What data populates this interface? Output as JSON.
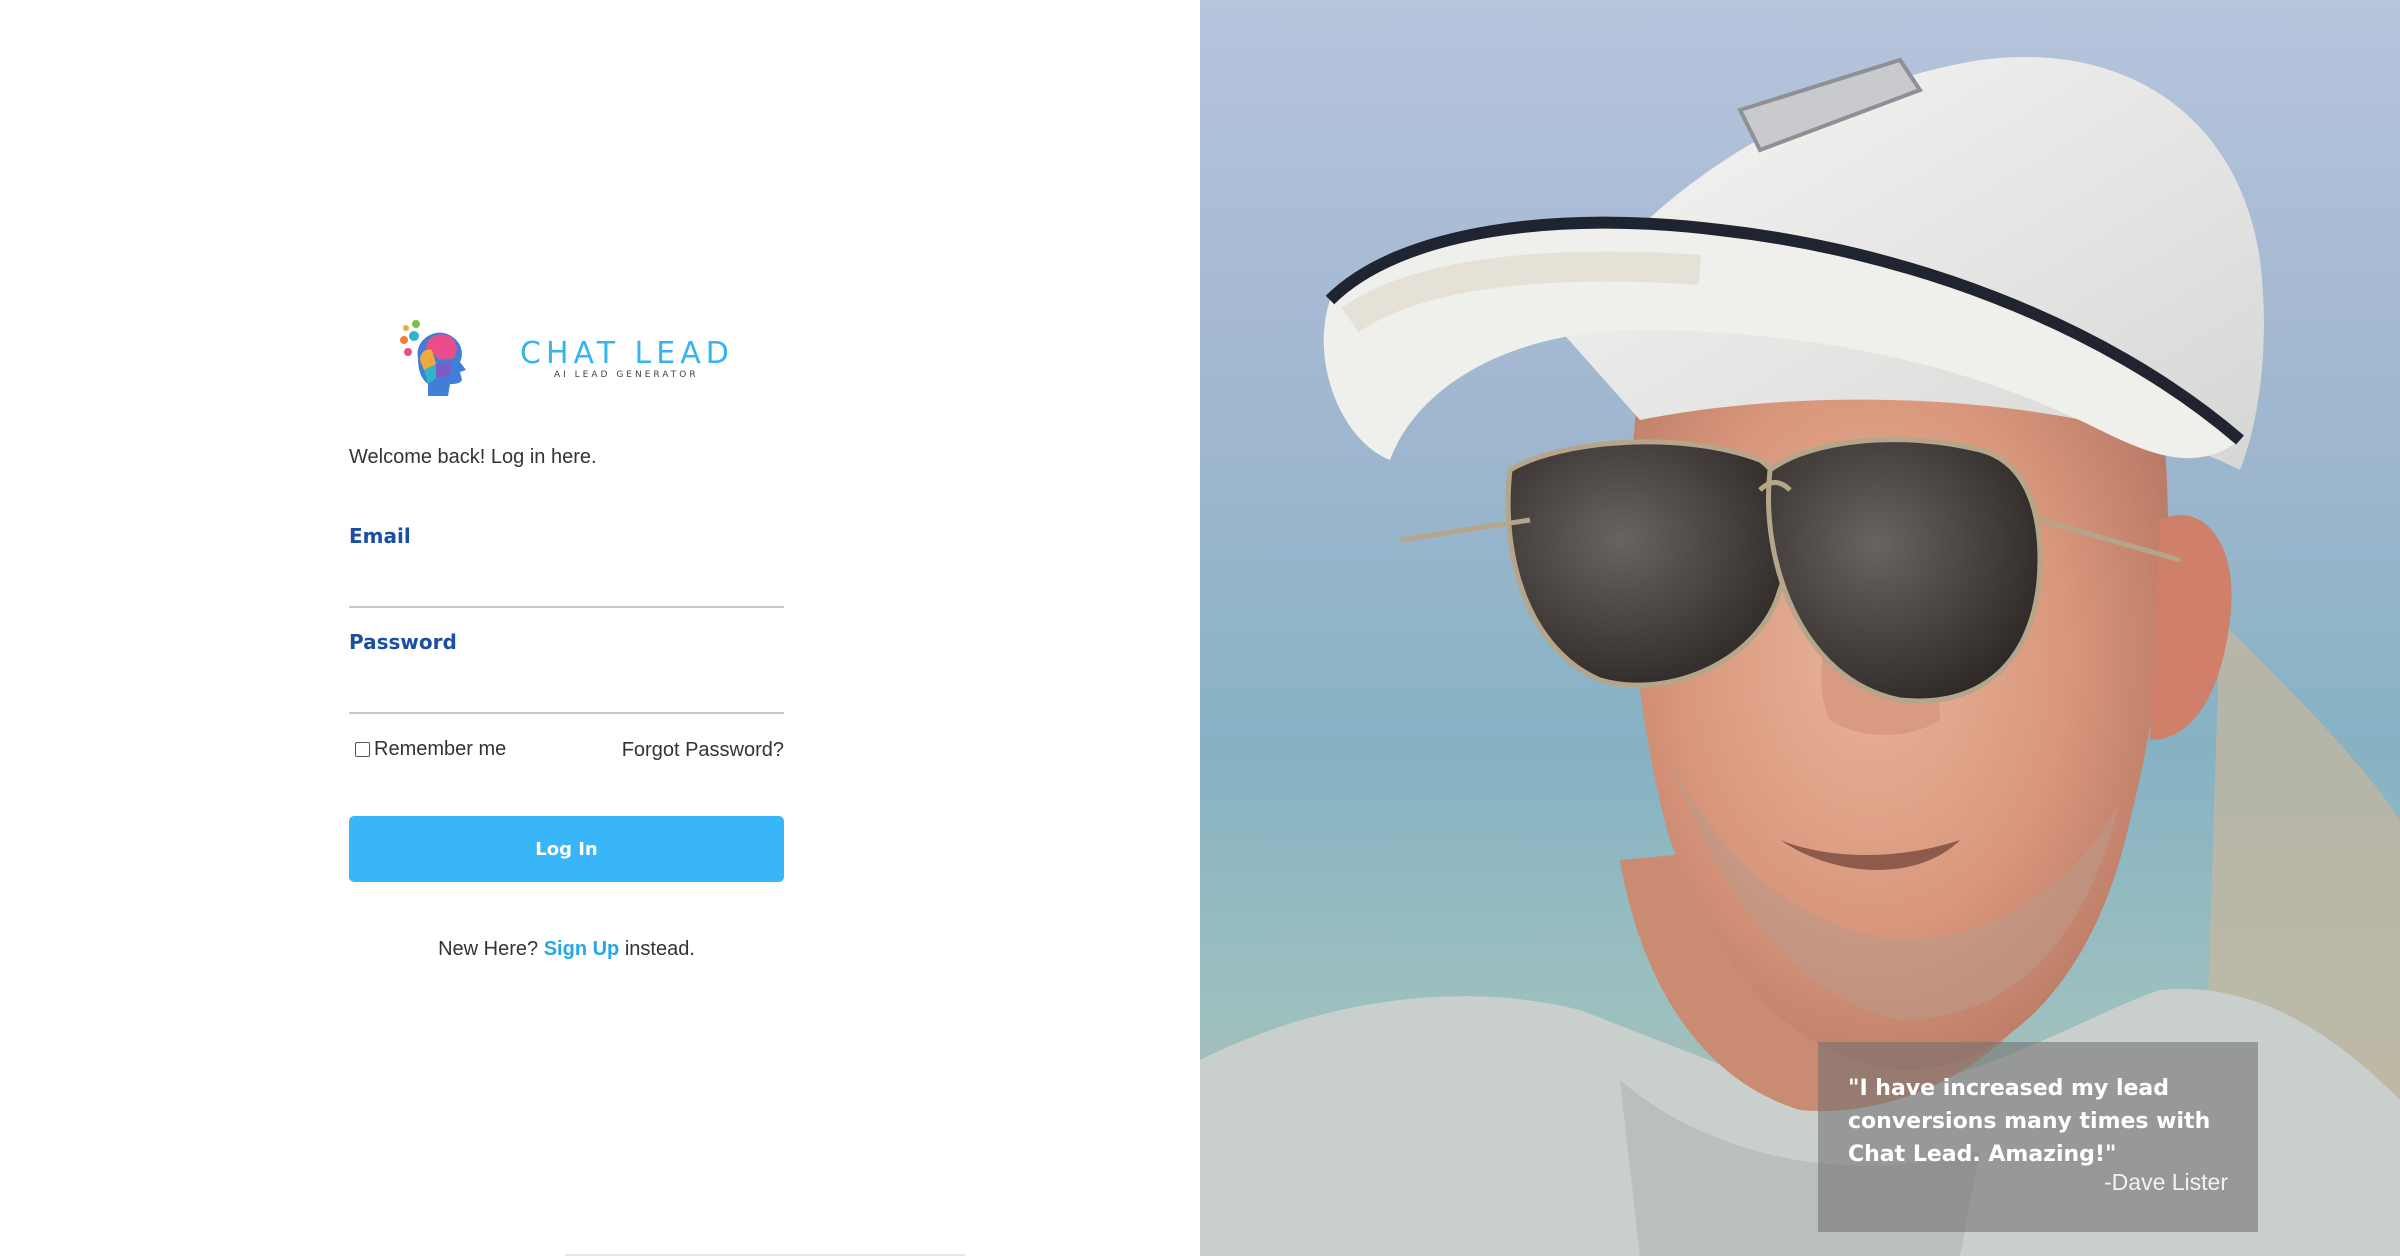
{
  "brand": {
    "name": "CHAT LEAD",
    "tagline": "AI LEAD GENERATOR",
    "logo_icon": "head-icon",
    "accent_color": "#39b6f7",
    "label_color": "#1b4fa3"
  },
  "login": {
    "welcome": "Welcome back! Log in here.",
    "email_label": "Email",
    "email_value": "",
    "password_label": "Password",
    "password_value": "",
    "remember_label": "Remember me",
    "remember_checked": false,
    "forgot_label": "Forgot Password?",
    "login_button": "Log In",
    "signup_prefix": "New Here? ",
    "signup_link": "Sign Up",
    "signup_suffix": " instead."
  },
  "testimonial": {
    "quote": "\"I have increased my lead conversions many times with Chat Lead. Amazing!\"",
    "author": "-Dave Lister"
  }
}
